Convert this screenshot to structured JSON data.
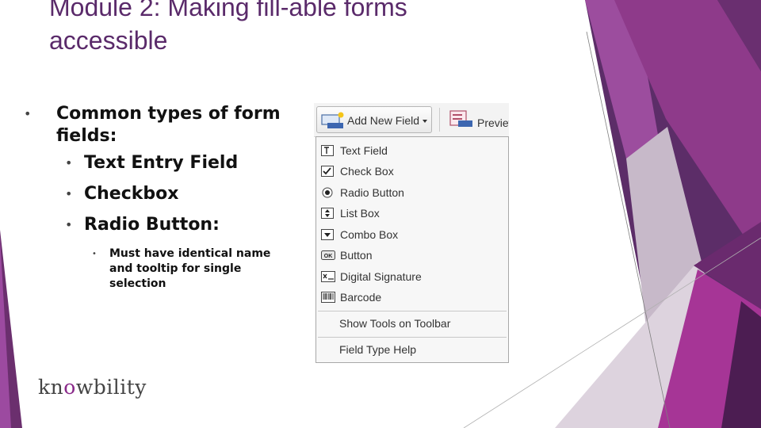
{
  "slide": {
    "title_line1": "Module 2: Making fill-able forms",
    "title_line2": "accessible"
  },
  "bullets": {
    "main": "Common types of form fields:",
    "items": [
      "Text Entry Field",
      "Checkbox",
      "Radio Button:"
    ],
    "sub_item": "Must have identical name and tooltip for single selection"
  },
  "logo": {
    "text_before": "kn",
    "text_o": "o",
    "text_after": "wbility"
  },
  "ribbon": {
    "add_new_field": "Add New Field",
    "preview": "Preview"
  },
  "menu": {
    "items": [
      {
        "label": "Text Field",
        "icon": "text-field-icon"
      },
      {
        "label": "Check Box",
        "icon": "checkbox-icon"
      },
      {
        "label": "Radio Button",
        "icon": "radio-button-icon"
      },
      {
        "label": "List Box",
        "icon": "list-box-icon"
      },
      {
        "label": "Combo Box",
        "icon": "combo-box-icon"
      },
      {
        "label": "Button",
        "icon": "button-icon"
      },
      {
        "label": "Digital Signature",
        "icon": "digital-signature-icon"
      },
      {
        "label": "Barcode",
        "icon": "barcode-icon"
      }
    ],
    "show_tools": "Show Tools on Toolbar",
    "field_type_help": "Field Type Help"
  },
  "colors": {
    "accent_purple": "#7b2a7f",
    "magenta": "#b8369b",
    "dark_purple": "#4a1f55",
    "title": "#5a2a6a"
  }
}
